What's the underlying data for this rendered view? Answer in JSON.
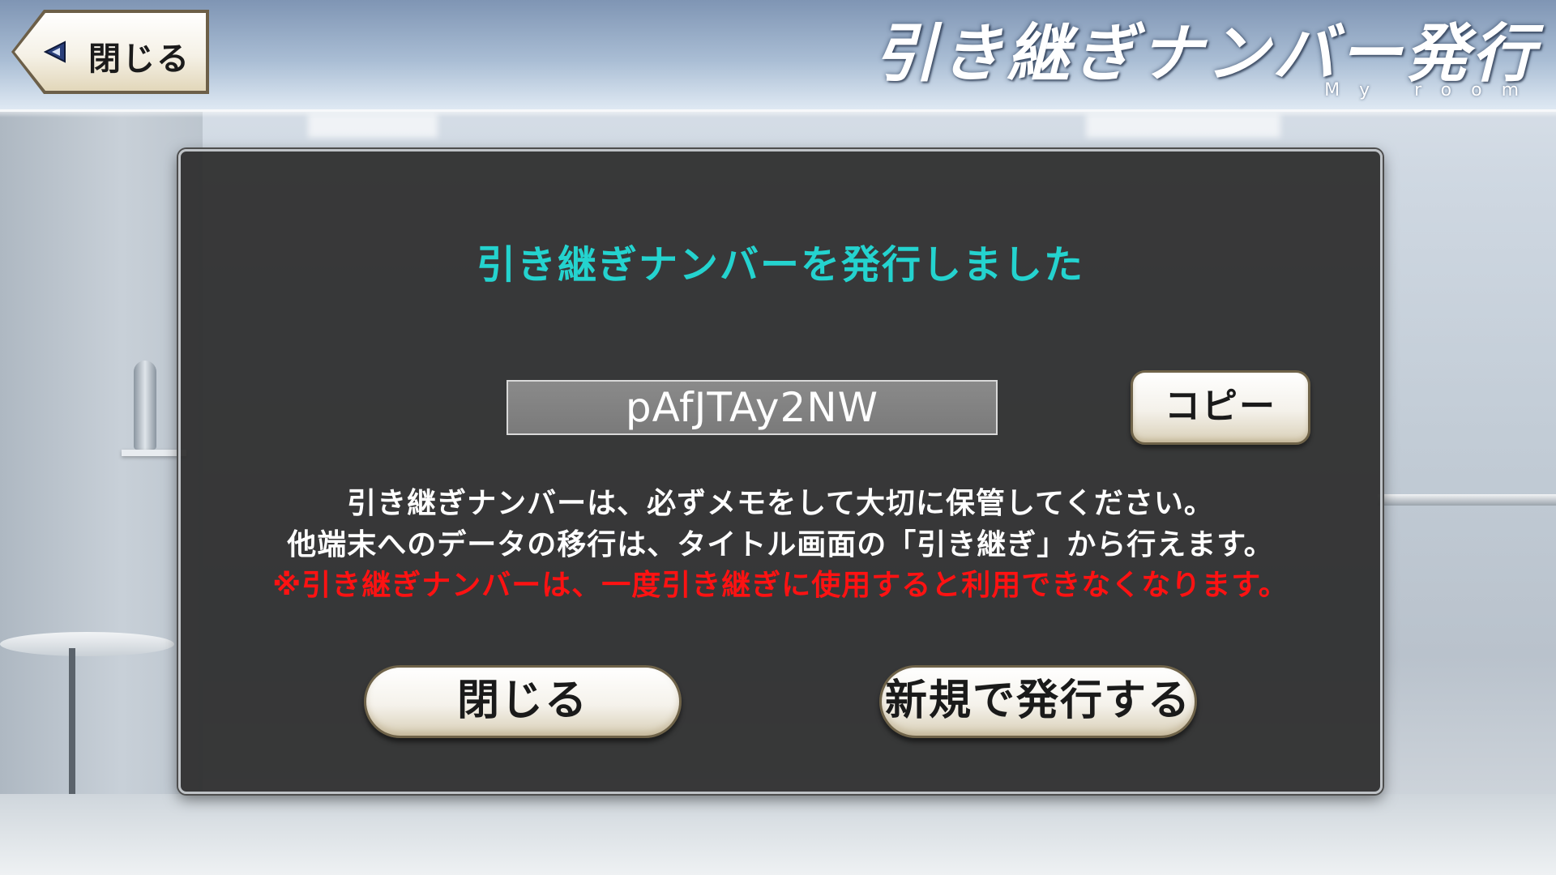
{
  "header": {
    "back_label": "閉じる",
    "title": "引き継ぎナンバー発行",
    "subtitle": "My room"
  },
  "dialog": {
    "title": "引き継ぎナンバーを発行しました",
    "code_value": "pAfJTAy2NW",
    "copy_label": "コピー",
    "info_line_1": "引き継ぎナンバーは、必ずメモをして大切に保管してください。",
    "info_line_2": "他端末へのデータの移行は、タイトル画面の「引き継ぎ」から行えます。",
    "warning": "※引き継ぎナンバーは、一度引き継ぎに使用すると利用できなくなります。",
    "close_label": "閉じる",
    "issue_new_label": "新規で発行する"
  },
  "colors": {
    "title_accent": "#24d3cf",
    "warning": "#ff1212",
    "dialog_bg": "#2c2c2c",
    "button_border": "#6f6349"
  }
}
